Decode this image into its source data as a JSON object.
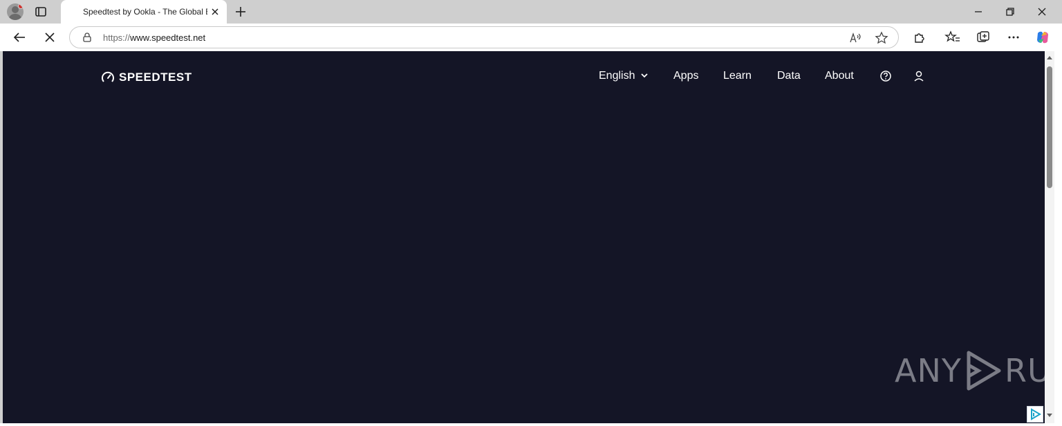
{
  "browser": {
    "tab_title": "Speedtest by Ookla - The Global Broadband Speed Test",
    "url_protocol": "https://",
    "url_host": "www.speedtest.net"
  },
  "page": {
    "logo_text": "SPEEDTEST",
    "nav": {
      "language": "English",
      "apps": "Apps",
      "learn": "Learn",
      "data": "Data",
      "about": "About"
    },
    "background_color": "#141526"
  },
  "watermark": {
    "left": "ANY",
    "right": "RUN"
  }
}
